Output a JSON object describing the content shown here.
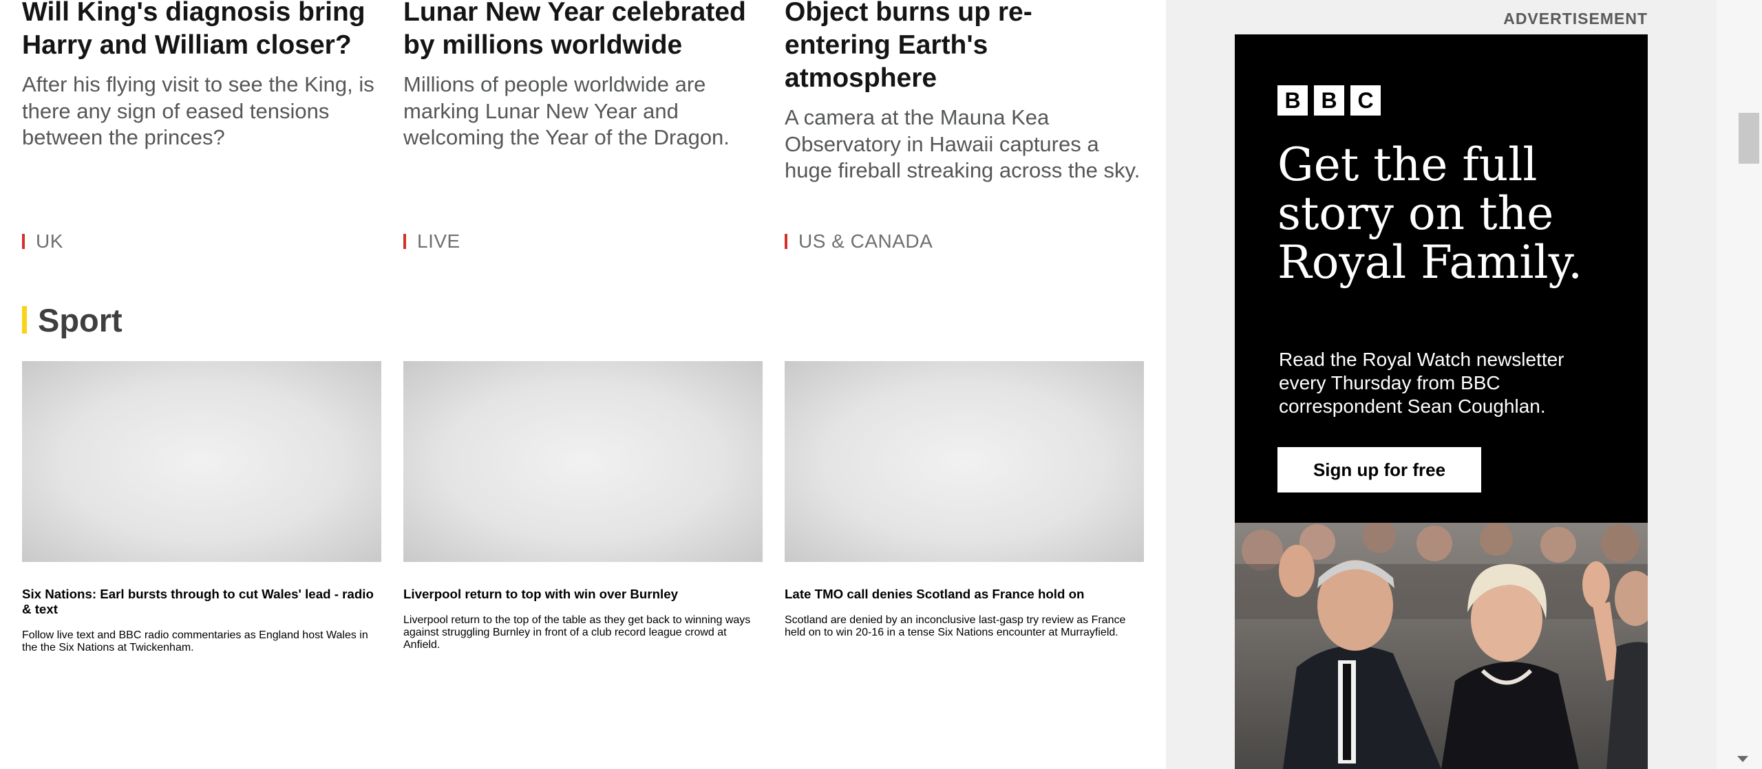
{
  "top_stories": [
    {
      "headline": "Will King's diagnosis bring Harry and William closer?",
      "summary": "After his flying visit to see the King, is there any sign of eased tensions between the princes?",
      "tag": "UK"
    },
    {
      "headline": "Lunar New Year celebrated by millions worldwide",
      "summary": "Millions of people worldwide are marking Lunar New Year and welcoming the Year of the Dragon.",
      "tag": "LIVE"
    },
    {
      "headline": "Object burns up re-entering Earth's atmosphere",
      "summary": "A camera at the Mauna Kea Observatory in Hawaii captures a huge fireball streaking across the sky.",
      "tag": "US & CANADA"
    }
  ],
  "sport": {
    "title": "Sport",
    "stories": [
      {
        "headline": "Six Nations: Earl bursts through to cut Wales' lead - radio & text",
        "summary": "Follow live text and BBC radio commentaries as England host Wales in the the Six Nations at Twickenham."
      },
      {
        "headline": "Liverpool return to top with win over Burnley",
        "summary": "Liverpool return to the top of the table as they get back to winning ways against struggling Burnley in front of a club record league crowd at Anfield."
      },
      {
        "headline": "Late TMO call denies Scotland as France hold on",
        "summary": "Scotland are denied by an inconclusive last-gasp try review as France held on to win 20-16 in a tense Six Nations encounter at Murrayfield."
      }
    ]
  },
  "advertisement": {
    "label": "ADVERTISEMENT",
    "logo_letters": [
      "B",
      "B",
      "C"
    ],
    "headline": "Get the full story on the Royal Family.",
    "body": "Read the Royal Watch newsletter every Thursday from BBC correspondent Sean Coughlan.",
    "button_label": "Sign up for free"
  },
  "colors": {
    "tag_accent": "#d2322b",
    "sport_accent": "#f9d21a",
    "headline_text": "#141414",
    "summary_text": "#545658"
  }
}
